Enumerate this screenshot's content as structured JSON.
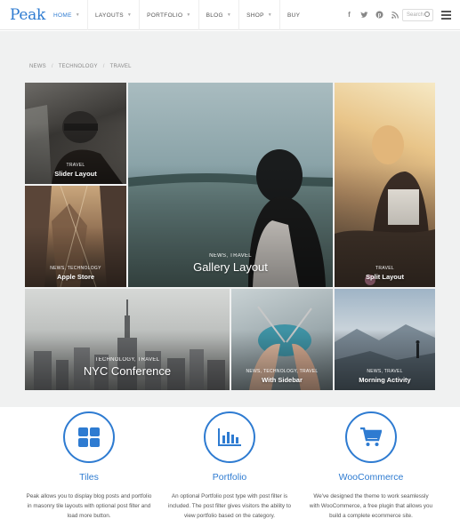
{
  "header": {
    "logo": "Peak",
    "nav": [
      {
        "label": "HOME",
        "caret": true,
        "active": true
      },
      {
        "label": "LAYOUTS",
        "caret": true
      },
      {
        "label": "PORTFOLIO",
        "caret": true
      },
      {
        "label": "BLOG",
        "caret": true
      },
      {
        "label": "SHOP",
        "caret": true
      },
      {
        "label": "BUY",
        "caret": false
      }
    ],
    "social": [
      "f",
      "t",
      "p",
      "rss"
    ],
    "search_placeholder": "Search"
  },
  "breadcrumbs": [
    "NEWS",
    "TECHNOLOGY",
    "TRAVEL"
  ],
  "tiles": {
    "slider": {
      "category": "TRAVEL",
      "title": "Slider Layout"
    },
    "apple": {
      "category": "NEWS, TECHNOLOGY",
      "title": "Apple Store"
    },
    "gallery": {
      "category": "NEWS, TRAVEL",
      "title": "Gallery Layout"
    },
    "split": {
      "category": "TRAVEL",
      "title": "Split Layout"
    },
    "nyc": {
      "category": "TECHNOLOGY, TRAVEL",
      "title": "NYC Conference"
    },
    "sidebar": {
      "category": "NEWS, TECHNOLOGY, TRAVEL",
      "title": "With Sidebar"
    },
    "morning": {
      "category": "NEWS, TRAVEL",
      "title": "Morning Activity"
    }
  },
  "features": [
    {
      "icon": "tiles-icon",
      "title": "Tiles",
      "text": "Peak allows you to display blog posts and portfolio in masonry tile layouts with optional post filter and load more button."
    },
    {
      "icon": "bar-chart-icon",
      "title": "Portfolio",
      "text": "An optional Portfolio post type with post filter is included. The post filter gives visitors the ability to view portfolio based on the category."
    },
    {
      "icon": "cart-icon",
      "title": "WooCommerce",
      "text": "We've designed the theme to work seamlessly with WooCommerce, a free plugin that allows you build a complete ecommerce site."
    }
  ],
  "colors": {
    "accent": "#2e7bd1",
    "band": "#f0f1f1"
  }
}
